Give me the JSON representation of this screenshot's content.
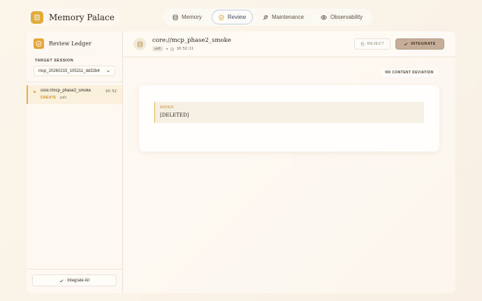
{
  "brand": {
    "name": "Memory Palace"
  },
  "nav": {
    "tabs": [
      {
        "label": "Memory",
        "icon": "database-icon",
        "active": false
      },
      {
        "label": "Review",
        "icon": "shield-icon",
        "active": true
      },
      {
        "label": "Maintenance",
        "icon": "feather-icon",
        "active": false
      },
      {
        "label": "Observability",
        "icon": "eye-icon",
        "active": false
      }
    ]
  },
  "sidebar": {
    "title": "Review Ledger",
    "target_label": "TARGET SESSION",
    "session": "mcp_20260215_105211_dd32b4",
    "items": [
      {
        "name": "core://mcp_phase2_smoke",
        "action": "CREATE",
        "kind": "path",
        "time": "10:52"
      }
    ],
    "integrate_all": "Integrate All"
  },
  "detail": {
    "title": "core://mcp_phase2_smoke",
    "path_chip": "path",
    "time": "10:52:11",
    "reject_label": "REJECT",
    "integrate_label": "INTEGRATE",
    "deviation_badge": "NO CONTENT DEVIATION",
    "diff": {
      "label": "ADDED",
      "text": "[DELETED]"
    }
  },
  "colors": {
    "accent": "#e1ad3a",
    "active_tab_border": "#bcd0e6",
    "integrate_button": "#c5ad99",
    "create_action": "#d38d21"
  }
}
